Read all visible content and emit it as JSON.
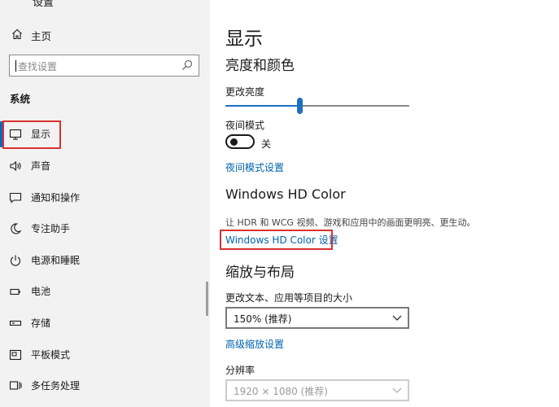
{
  "sidebar": {
    "top_partial_label": "设置",
    "home_label": "主页",
    "search_placeholder": "查找设置",
    "section_title": "系统",
    "items": [
      {
        "label": "显示",
        "icon": "monitor-icon"
      },
      {
        "label": "声音",
        "icon": "speaker-icon"
      },
      {
        "label": "通知和操作",
        "icon": "notification-icon"
      },
      {
        "label": "专注助手",
        "icon": "moon-icon"
      },
      {
        "label": "电源和睡眠",
        "icon": "power-icon"
      },
      {
        "label": "电池",
        "icon": "battery-icon"
      },
      {
        "label": "存储",
        "icon": "storage-icon"
      },
      {
        "label": "平板模式",
        "icon": "tablet-icon"
      },
      {
        "label": "多任务处理",
        "icon": "multitask-icon"
      }
    ]
  },
  "main": {
    "title": "显示",
    "brightness_section": {
      "heading": "亮度和颜色",
      "brightness_label": "更改亮度",
      "brightness_value_percent": 40,
      "night_mode_label": "夜间模式",
      "night_mode_state": "关",
      "night_mode_link": "夜间模式设置"
    },
    "hd_color_section": {
      "heading": "Windows HD Color",
      "description": "让 HDR 和 WCG 视频、游戏和应用中的画面更明亮、更生动。",
      "link": "Windows HD Color 设置"
    },
    "scale_section": {
      "heading": "缩放与布局",
      "scale_label": "更改文本、应用等项目的大小",
      "scale_value": "150% (推荐)",
      "advanced_link": "高级缩放设置",
      "resolution_label": "分辨率",
      "resolution_value": "1920 × 1080 (推荐)"
    }
  },
  "colors": {
    "accent": "#0067c0",
    "link": "#0063b1",
    "highlight_box": "#d8322f",
    "sidebar_bg": "#f2f2f2"
  }
}
